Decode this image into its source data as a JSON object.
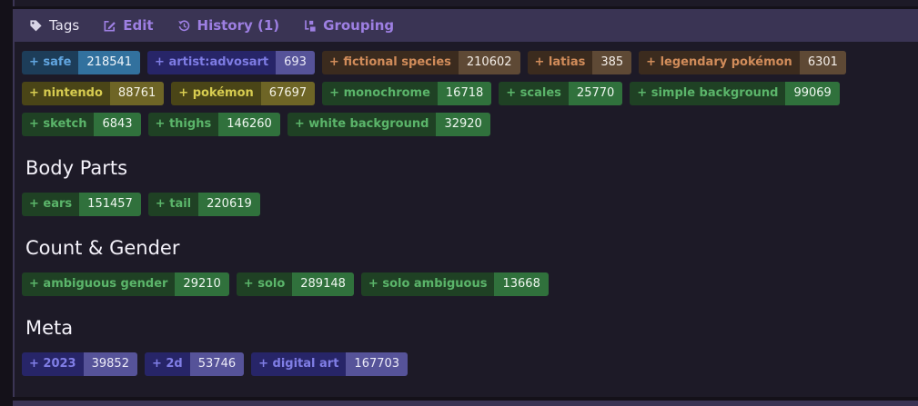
{
  "panel": {
    "header": {
      "tags_label": "Tags",
      "edit_label": "Edit",
      "history_label": "History (1)",
      "grouping_label": "Grouping",
      "bar_color": "#3a3454",
      "link_color": "#9d7fe2",
      "title_color": "#e9e6f3"
    },
    "tag_plus": "+",
    "categories": {
      "rating": {
        "bg": "#1d3d59",
        "text": "#61a5e0",
        "count_bg": "#32719e",
        "count_text": "#f2f7fc"
      },
      "artist": {
        "bg": "#272568",
        "text": "#7e7ce4",
        "count_bg": "#565399",
        "count_text": "#ecebf8"
      },
      "species": {
        "bg": "#3b2b1e",
        "text": "#d18c5a",
        "count_bg": "#5e4935",
        "count_text": "#f5efe9"
      },
      "copyright": {
        "bg": "#4a4517",
        "text": "#d7cc50",
        "count_bg": "#6e6526",
        "count_text": "#f5f3e6"
      },
      "general": {
        "bg": "#1f4124",
        "text": "#5bb56a",
        "count_bg": "#30713c",
        "count_text": "#eff7f0"
      },
      "meta": {
        "bg": "#272568",
        "text": "#807ee6",
        "count_bg": "#565399",
        "count_text": "#ecebf8"
      }
    },
    "groups": [
      {
        "heading": null,
        "tags": [
          {
            "label": "safe",
            "count": "218541",
            "category": "rating"
          },
          {
            "label": "artist:advosart",
            "count": "693",
            "category": "artist"
          },
          {
            "label": "fictional species",
            "count": "210602",
            "category": "species"
          },
          {
            "label": "latias",
            "count": "385",
            "category": "species"
          },
          {
            "label": "legendary pokémon",
            "count": "6301",
            "category": "species"
          },
          {
            "label": "nintendo",
            "count": "88761",
            "category": "copyright"
          },
          {
            "label": "pokémon",
            "count": "67697",
            "category": "copyright"
          },
          {
            "label": "monochrome",
            "count": "16718",
            "category": "general"
          },
          {
            "label": "scales",
            "count": "25770",
            "category": "general"
          },
          {
            "label": "simple background",
            "count": "99069",
            "category": "general"
          },
          {
            "label": "sketch",
            "count": "6843",
            "category": "general"
          },
          {
            "label": "thighs",
            "count": "146260",
            "category": "general"
          },
          {
            "label": "white background",
            "count": "32920",
            "category": "general"
          }
        ]
      },
      {
        "heading": "Body Parts",
        "tags": [
          {
            "label": "ears",
            "count": "151457",
            "category": "general"
          },
          {
            "label": "tail",
            "count": "220619",
            "category": "general"
          }
        ]
      },
      {
        "heading": "Count & Gender",
        "tags": [
          {
            "label": "ambiguous gender",
            "count": "29210",
            "category": "general"
          },
          {
            "label": "solo",
            "count": "289148",
            "category": "general"
          },
          {
            "label": "solo ambiguous",
            "count": "13668",
            "category": "general"
          }
        ]
      },
      {
        "heading": "Meta",
        "tags": [
          {
            "label": "2023",
            "count": "39852",
            "category": "meta"
          },
          {
            "label": "2d",
            "count": "53746",
            "category": "meta"
          },
          {
            "label": "digital art",
            "count": "167703",
            "category": "meta"
          }
        ]
      }
    ]
  }
}
